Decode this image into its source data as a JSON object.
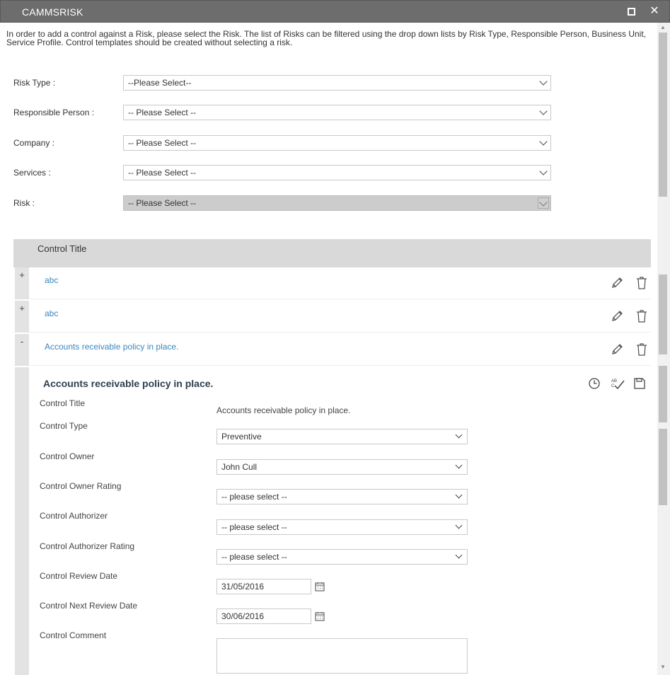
{
  "window": {
    "title": "CAMMSRISK"
  },
  "intro_text": "In order to add a control against a Risk, please select the Risk. The list of Risks can be filtered using the drop down lists by Risk Type, Responsible Person, Business Unit, Service Profile. Control templates should be created without selecting a risk.",
  "filters": [
    {
      "label": "Risk Type :",
      "value": "--Please Select--"
    },
    {
      "label": "Responsible Person :",
      "value": "-- Please Select --"
    },
    {
      "label": "Company :",
      "value": "-- Please Select --"
    },
    {
      "label": "Services :",
      "value": "-- Please Select --"
    },
    {
      "label": "Risk :",
      "value": "-- Please Select --"
    }
  ],
  "grid": {
    "header": "Control Title",
    "rows": [
      {
        "expander": "+",
        "title": "abc"
      },
      {
        "expander": "+",
        "title": "abc"
      },
      {
        "expander": "-",
        "title": "Accounts receivable policy in place."
      }
    ]
  },
  "detail": {
    "heading": "Accounts receivable policy in place.",
    "fields": {
      "control_title_label": "Control Title",
      "control_title_value": "Accounts receivable policy in place.",
      "control_type_label": "Control Type",
      "control_type_value": "Preventive",
      "control_owner_label": "Control Owner",
      "control_owner_value": "John Cull",
      "owner_rating_label": "Control Owner Rating",
      "owner_rating_value": "-- please select --",
      "authorizer_label": "Control Authorizer",
      "authorizer_value": "-- please select --",
      "authorizer_rating_label": "Control Authorizer Rating",
      "authorizer_rating_value": "-- please select --",
      "review_date_label": "Control Review Date",
      "review_date_value": "31/05/2016",
      "next_review_date_label": "Control Next Review Date",
      "next_review_date_value": "30/06/2016",
      "comment_label": "Control Comment"
    }
  }
}
